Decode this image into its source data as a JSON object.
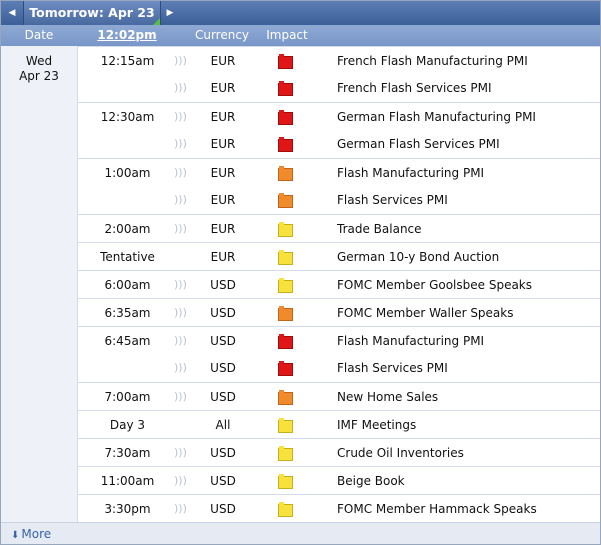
{
  "nav": {
    "prev_icon": "◀",
    "next_icon": "▶",
    "title": "Tomorrow: Apr 23"
  },
  "columns": {
    "date": "Date",
    "time": "12:02pm",
    "currency": "Currency",
    "impact": "Impact"
  },
  "day": {
    "weekday": "Wed",
    "date": "Apr 23"
  },
  "colors": {
    "high": "#e01515",
    "medium": "#f08a2a",
    "low": "#f6e23a",
    "header": "#7896c8",
    "link": "#3a63a8"
  },
  "events": [
    {
      "time": "12:15am",
      "alarm": ")))",
      "currency": "EUR",
      "impact": "high",
      "impact_icon": "red-folder-icon",
      "title": "French Flash Manufacturing PMI"
    },
    {
      "time": "",
      "alarm": ")))",
      "currency": "EUR",
      "impact": "high",
      "impact_icon": "red-folder-icon",
      "title": "French Flash Services PMI"
    },
    {
      "time": "12:30am",
      "alarm": ")))",
      "currency": "EUR",
      "impact": "high",
      "impact_icon": "red-folder-icon",
      "title": "German Flash Manufacturing PMI"
    },
    {
      "time": "",
      "alarm": ")))",
      "currency": "EUR",
      "impact": "high",
      "impact_icon": "red-folder-icon",
      "title": "German Flash Services PMI"
    },
    {
      "time": "1:00am",
      "alarm": ")))",
      "currency": "EUR",
      "impact": "medium",
      "impact_icon": "orange-folder-icon",
      "title": "Flash Manufacturing PMI"
    },
    {
      "time": "",
      "alarm": ")))",
      "currency": "EUR",
      "impact": "medium",
      "impact_icon": "orange-folder-icon",
      "title": "Flash Services PMI"
    },
    {
      "time": "2:00am",
      "alarm": ")))",
      "currency": "EUR",
      "impact": "low",
      "impact_icon": "yellow-folder-icon",
      "title": "Trade Balance"
    },
    {
      "time": "Tentative",
      "alarm": "",
      "currency": "EUR",
      "impact": "low",
      "impact_icon": "yellow-folder-icon",
      "title": "German 10-y Bond Auction"
    },
    {
      "time": "6:00am",
      "alarm": ")))",
      "currency": "USD",
      "impact": "low",
      "impact_icon": "yellow-folder-icon",
      "title": "FOMC Member Goolsbee Speaks"
    },
    {
      "time": "6:35am",
      "alarm": ")))",
      "currency": "USD",
      "impact": "medium",
      "impact_icon": "orange-folder-icon",
      "title": "FOMC Member Waller Speaks"
    },
    {
      "time": "6:45am",
      "alarm": ")))",
      "currency": "USD",
      "impact": "high",
      "impact_icon": "red-folder-icon",
      "title": "Flash Manufacturing PMI"
    },
    {
      "time": "",
      "alarm": ")))",
      "currency": "USD",
      "impact": "high",
      "impact_icon": "red-folder-icon",
      "title": "Flash Services PMI"
    },
    {
      "time": "7:00am",
      "alarm": ")))",
      "currency": "USD",
      "impact": "medium",
      "impact_icon": "orange-folder-icon",
      "title": "New Home Sales"
    },
    {
      "time": "Day 3",
      "alarm": "",
      "currency": "All",
      "impact": "low",
      "impact_icon": "yellow-folder-icon",
      "title": "IMF Meetings"
    },
    {
      "time": "7:30am",
      "alarm": ")))",
      "currency": "USD",
      "impact": "low",
      "impact_icon": "yellow-folder-icon",
      "title": "Crude Oil Inventories"
    },
    {
      "time": "11:00am",
      "alarm": ")))",
      "currency": "USD",
      "impact": "low",
      "impact_icon": "yellow-folder-icon",
      "title": "Beige Book"
    },
    {
      "time": "3:30pm",
      "alarm": ")))",
      "currency": "USD",
      "impact": "low",
      "impact_icon": "yellow-folder-icon",
      "title": "FOMC Member Hammack Speaks"
    }
  ],
  "footer": {
    "more_icon": "⬇",
    "more_label": "More"
  }
}
